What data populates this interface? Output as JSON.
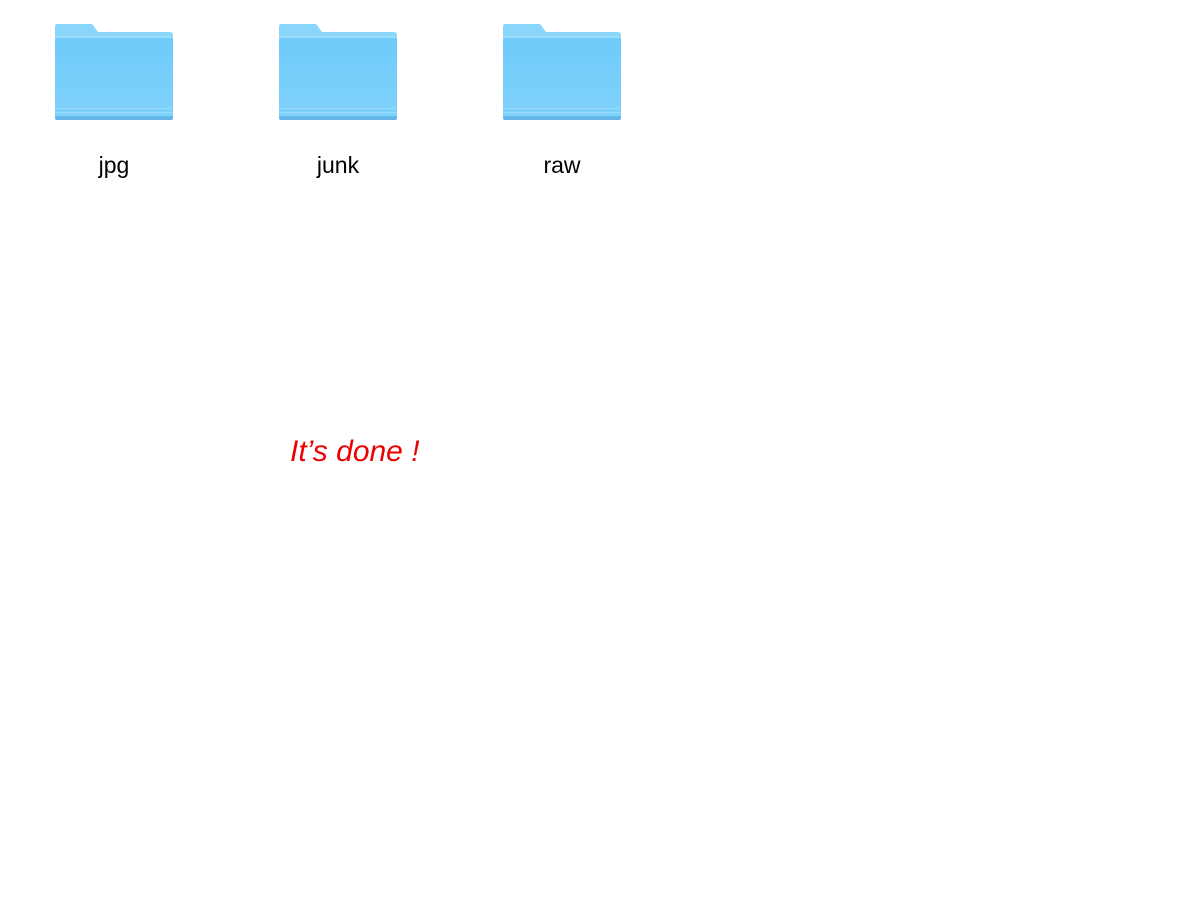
{
  "folders": [
    {
      "name": "jpg",
      "icon": "folder-icon"
    },
    {
      "name": "junk",
      "icon": "folder-icon"
    },
    {
      "name": "raw",
      "icon": "folder-icon"
    }
  ],
  "message": "It’s done !",
  "colors": {
    "message": "#ee0000",
    "folder_back": "#7fcdf7",
    "folder_front": "#6cc8fa"
  }
}
